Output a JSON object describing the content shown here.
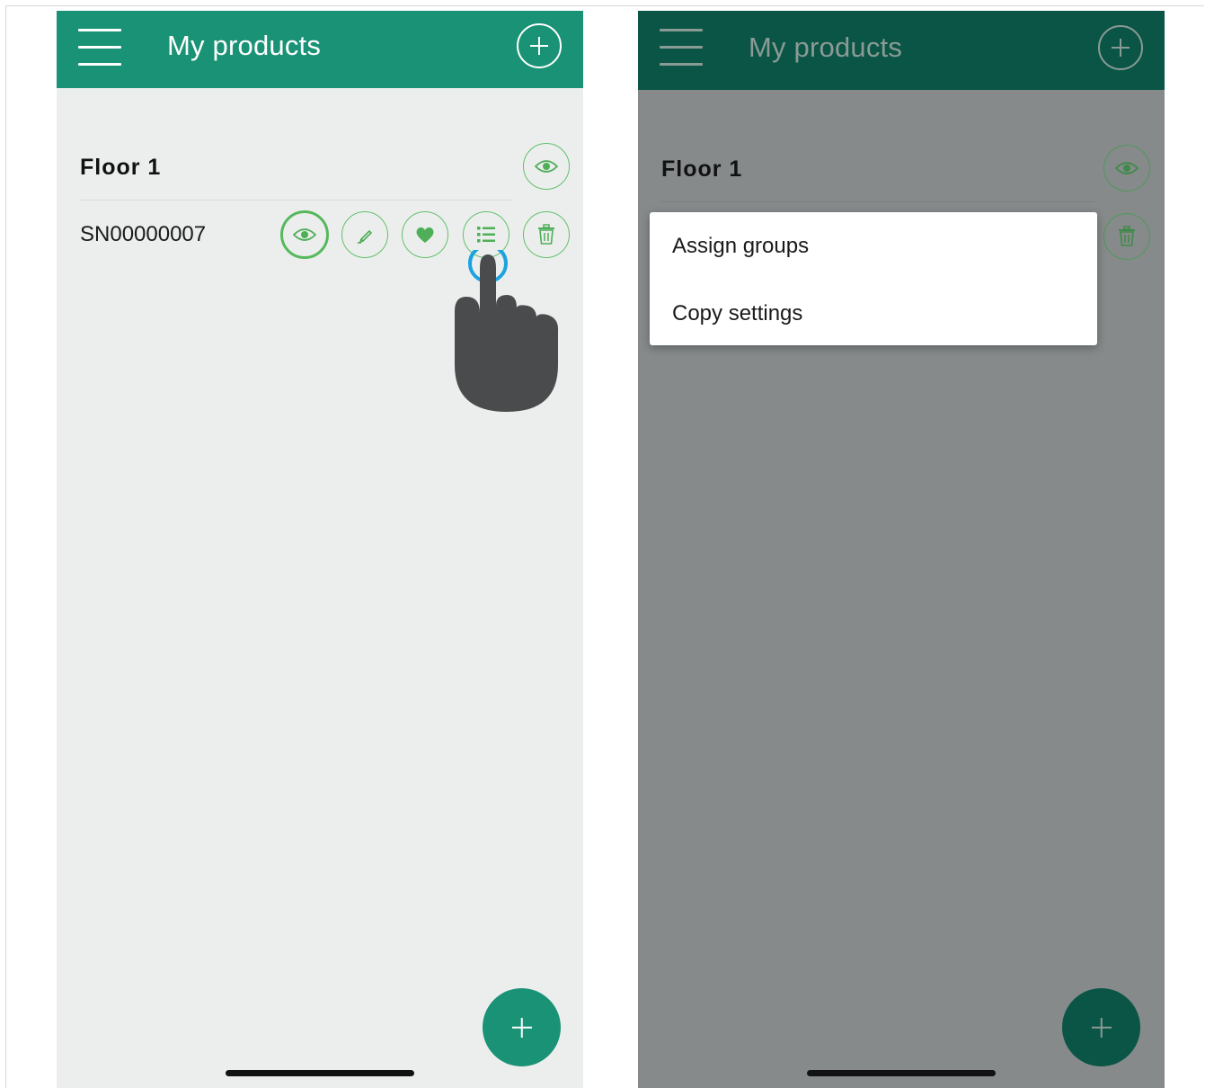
{
  "screens": [
    {
      "header": {
        "title": "My products"
      },
      "group": {
        "name": "Floor 1"
      },
      "product": {
        "serial": "SN00000007"
      }
    },
    {
      "header": {
        "title": "My products"
      },
      "group": {
        "name": "Floor 1"
      },
      "popup_menu": {
        "items": [
          {
            "label": "Assign groups"
          },
          {
            "label": "Copy settings"
          }
        ]
      }
    }
  ],
  "colors": {
    "header_green": "#1a9275",
    "header_green_dimmed": "#0a5545",
    "icon_green": "#62c06b",
    "tap_ring": "#1aa3e0",
    "overlay_gray": "#868a8b"
  },
  "icons": {
    "menu": "hamburger-icon",
    "add": "plus-icon",
    "view": "eye-icon",
    "edit": "pencil-icon",
    "favorite": "heart-icon",
    "more": "list-icon",
    "delete": "trash-icon",
    "gesture": "tap-hand-icon"
  }
}
